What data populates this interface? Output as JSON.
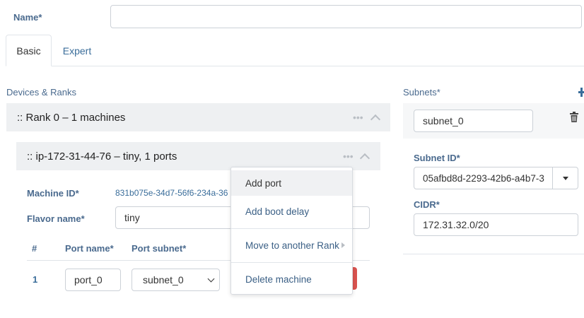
{
  "form": {
    "name_label": "Name*",
    "name_value": ""
  },
  "tabs": [
    {
      "label": "Basic",
      "active": true
    },
    {
      "label": "Expert",
      "active": false
    }
  ],
  "devices": {
    "title": "Devices & Ranks",
    "rank_header": ":: Rank 0 – 1 machines",
    "machine_header": ":: ip-172-31-44-76 – tiny, 1 ports",
    "dots": "•••",
    "machine_id_label": "Machine ID*",
    "machine_id_value": "831b075e-34d7-56f6-234a-36",
    "flavor_label": "Flavor name*",
    "flavor_value": "tiny",
    "ports_table": {
      "headers": [
        "#",
        "Port name*",
        "Port subnet*"
      ],
      "rows": [
        {
          "index": "1",
          "port_name": "port_0",
          "port_subnet": "subnet_0"
        }
      ]
    }
  },
  "context_menu": {
    "items": [
      "Add port",
      "Add boot delay",
      "Move to another Rank",
      "Delete machine"
    ]
  },
  "subnets": {
    "title": "Subnets*",
    "add_icon": "plus-icon",
    "subnet_name_value": "subnet_0",
    "delete_icon": "trash-icon",
    "subnet_id_label": "Subnet ID*",
    "subnet_id_value": "05afbd8d-2293-42b6-a4b7-3",
    "cidr_label": "CIDR*",
    "cidr_value": "172.31.32.0/20"
  },
  "colors": {
    "accent_red": "#d9534f",
    "label_blue": "#4a6a8e",
    "link_blue": "#3a6d9a"
  }
}
